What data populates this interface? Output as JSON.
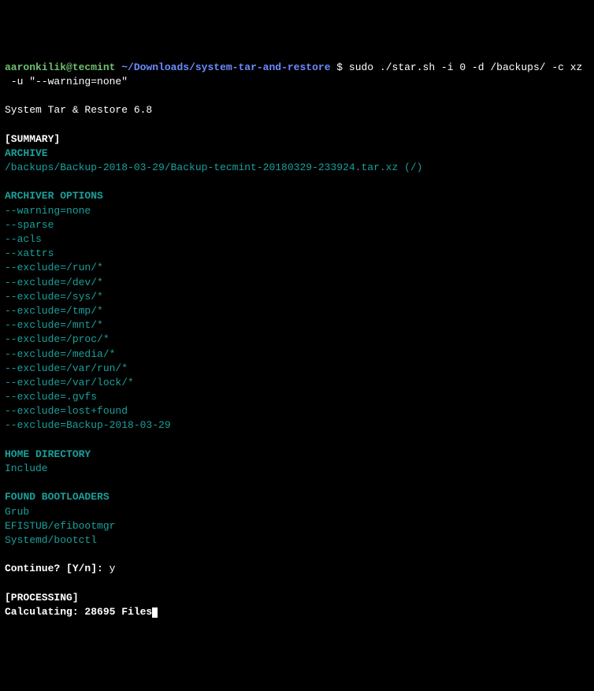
{
  "prompt": {
    "user_host": "aaronkilik@tecmint",
    "separator": " ",
    "path": "~/Downloads/system-tar-and-restore",
    "dollar": " $ ",
    "command": "sudo ./star.sh -i 0 -d /backups/ -c xz",
    "command_cont_indent": " ",
    "command_cont": "-u \"--warning=none\""
  },
  "title": "System Tar & Restore 6.8",
  "summary_header": "[SUMMARY]",
  "archive_label": "ARCHIVE",
  "archive_path": "/backups/Backup-2018-03-29/Backup-tecmint-20180329-233924.tar.xz (/)",
  "archiver_options_label": "ARCHIVER OPTIONS",
  "archiver_options": [
    "--warning=none",
    "--sparse",
    "--acls",
    "--xattrs",
    "--exclude=/run/*",
    "--exclude=/dev/*",
    "--exclude=/sys/*",
    "--exclude=/tmp/*",
    "--exclude=/mnt/*",
    "--exclude=/proc/*",
    "--exclude=/media/*",
    "--exclude=/var/run/*",
    "--exclude=/var/lock/*",
    "--exclude=.gvfs",
    "--exclude=lost+found",
    "--exclude=Backup-2018-03-29"
  ],
  "home_dir_label": "HOME DIRECTORY",
  "home_dir_value": "Include",
  "bootloaders_label": "FOUND BOOTLOADERS",
  "bootloaders": [
    "Grub",
    "EFISTUB/efibootmgr",
    "Systemd/bootctl"
  ],
  "continue_prompt": "Continue? [Y/n]: ",
  "continue_answer": "y",
  "processing_header": "[PROCESSING]",
  "processing_status": "Calculating: 28695 Files"
}
